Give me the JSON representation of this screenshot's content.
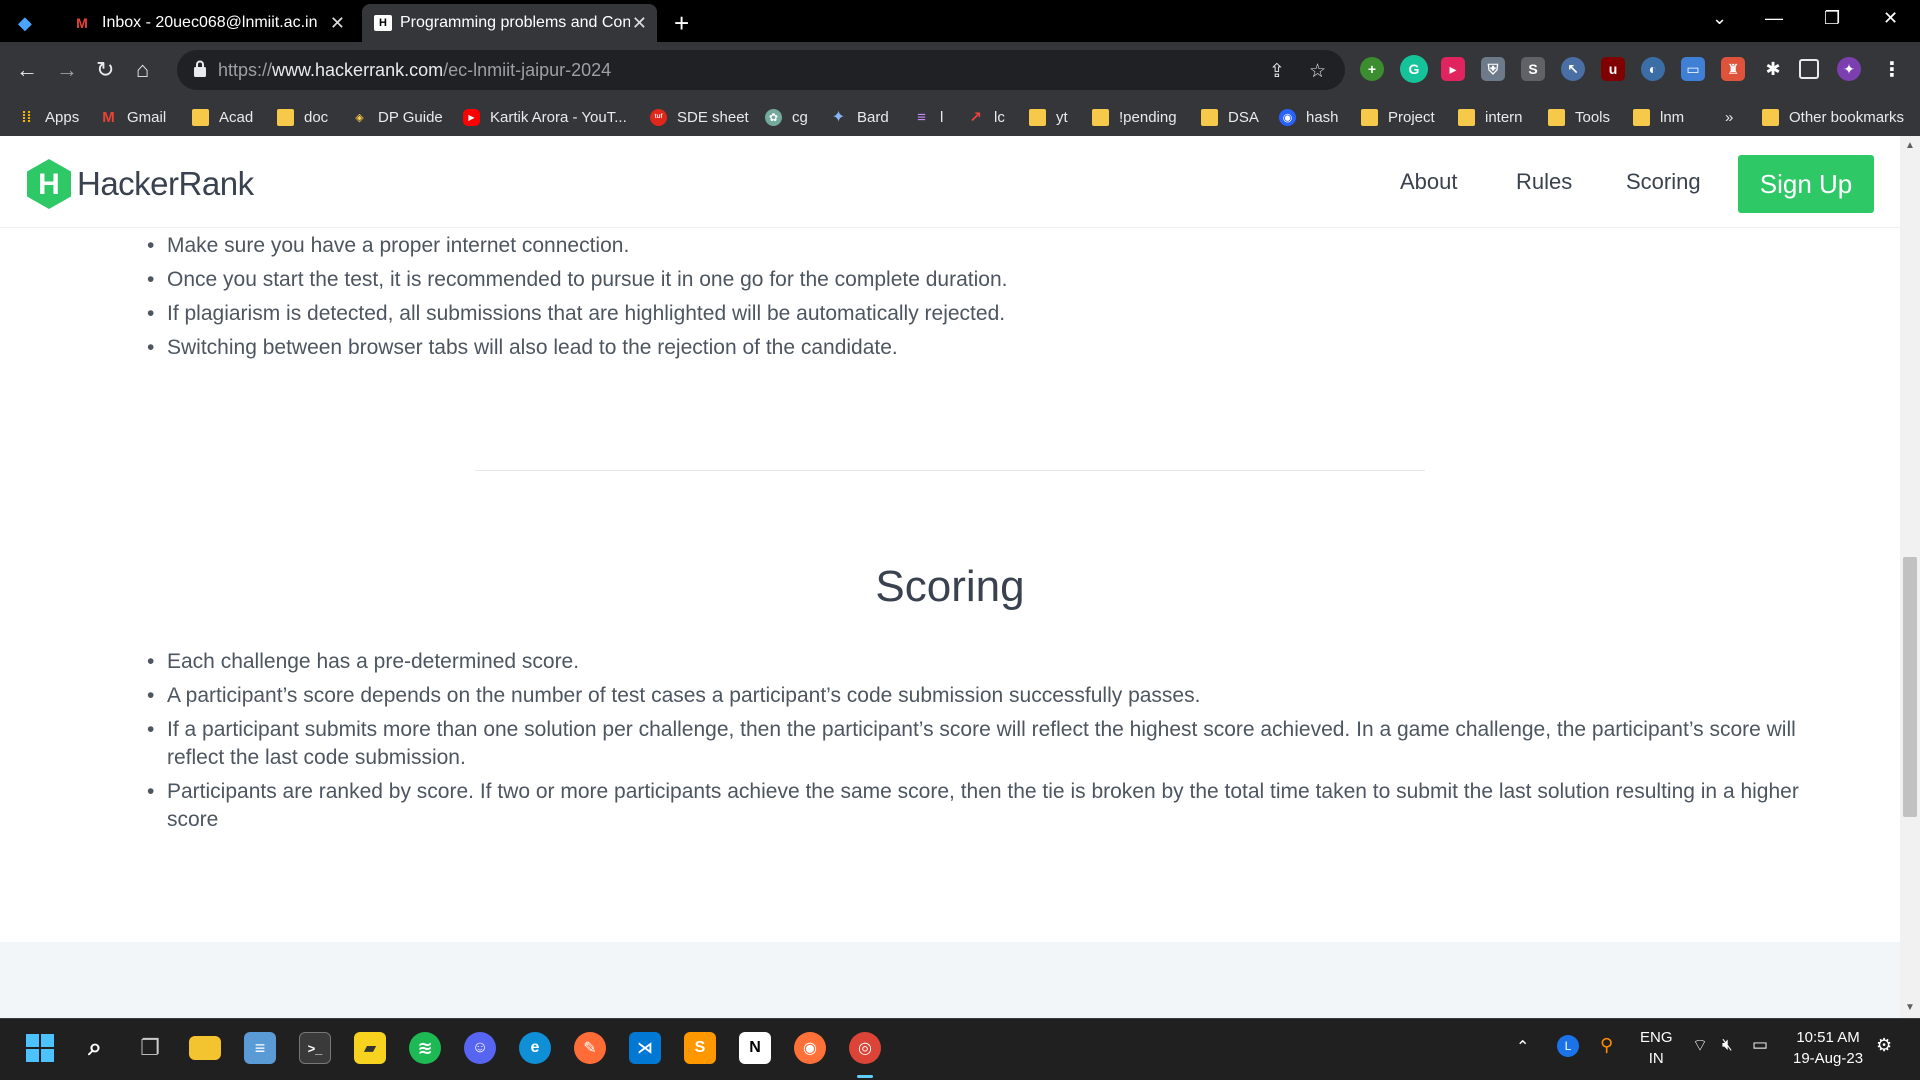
{
  "browser": {
    "tabs": [
      {
        "title": "Inbox - 20uec068@lnmiit.ac.in - ",
        "icon": "gmail-icon"
      },
      {
        "title": "Programming problems and Con",
        "icon": "hackerrank-icon"
      }
    ],
    "new_tab_label": "+",
    "url_prefix": "https://",
    "url_domain": "www.hackerrank.com",
    "url_path": "/ec-lnmiit-jaipur-2024",
    "bookmarks": [
      {
        "label": "Apps",
        "icon": "apps-grid-icon"
      },
      {
        "label": "Gmail",
        "icon": "gmail-icon"
      },
      {
        "label": "Acad",
        "icon": "folder-icon"
      },
      {
        "label": "doc",
        "icon": "folder-icon"
      },
      {
        "label": "DP Guide",
        "icon": "dp-guide-icon"
      },
      {
        "label": "Kartik Arora - YouT...",
        "icon": "youtube-icon"
      },
      {
        "label": "SDE sheet",
        "icon": "tuf-icon"
      },
      {
        "label": "cg",
        "icon": "chatgpt-icon"
      },
      {
        "label": "Bard",
        "icon": "bard-icon"
      },
      {
        "label": "l",
        "icon": "list-icon"
      },
      {
        "label": "lc",
        "icon": "trend-icon"
      },
      {
        "label": "yt",
        "icon": "folder-icon"
      },
      {
        "label": "!pending",
        "icon": "folder-icon"
      },
      {
        "label": "DSA",
        "icon": "folder-icon"
      },
      {
        "label": "hash",
        "icon": "hashnode-icon"
      },
      {
        "label": "Project",
        "icon": "folder-icon"
      },
      {
        "label": "intern",
        "icon": "folder-icon"
      },
      {
        "label": "Tools",
        "icon": "folder-icon"
      },
      {
        "label": "lnm",
        "icon": "folder-icon"
      }
    ],
    "more_bookmarks": "»",
    "other_bookmarks": "Other bookmarks"
  },
  "header": {
    "brand": "HackerRank",
    "logo_letter": "H",
    "nav": [
      "About",
      "Rules",
      "Scoring"
    ],
    "signup": "Sign Up"
  },
  "rules_bullets": [
    "Make sure you have a proper internet connection.",
    "Once you start the test, it is recommended to pursue it in one go for the complete duration.",
    "If plagiarism is detected, all submissions that are highlighted will be automatically rejected.",
    "Switching between browser tabs will also lead to the rejection of the candidate."
  ],
  "scoring": {
    "title": "Scoring",
    "bullets": [
      "Each challenge has a pre-determined score.",
      "A participant’s score depends on the number of test cases a participant’s code submission successfully passes.",
      "If a participant submits more than one solution per challenge, then the participant’s score will reflect the highest score achieved. In a game challenge, the participant’s score will reflect the last code submission.",
      "Participants are ranked by score. If two or more participants achieve the same score, then the tie is broken by the total time taken to submit the last solution resulting in a higher score"
    ]
  },
  "taskbar": {
    "lang_top": "ENG",
    "lang_bottom": "IN",
    "time": "10:51 AM",
    "date": "19-Aug-23"
  },
  "colors": {
    "accent_green": "#2ec866",
    "chrome_dark": "#35363a",
    "text": "#39424e"
  }
}
